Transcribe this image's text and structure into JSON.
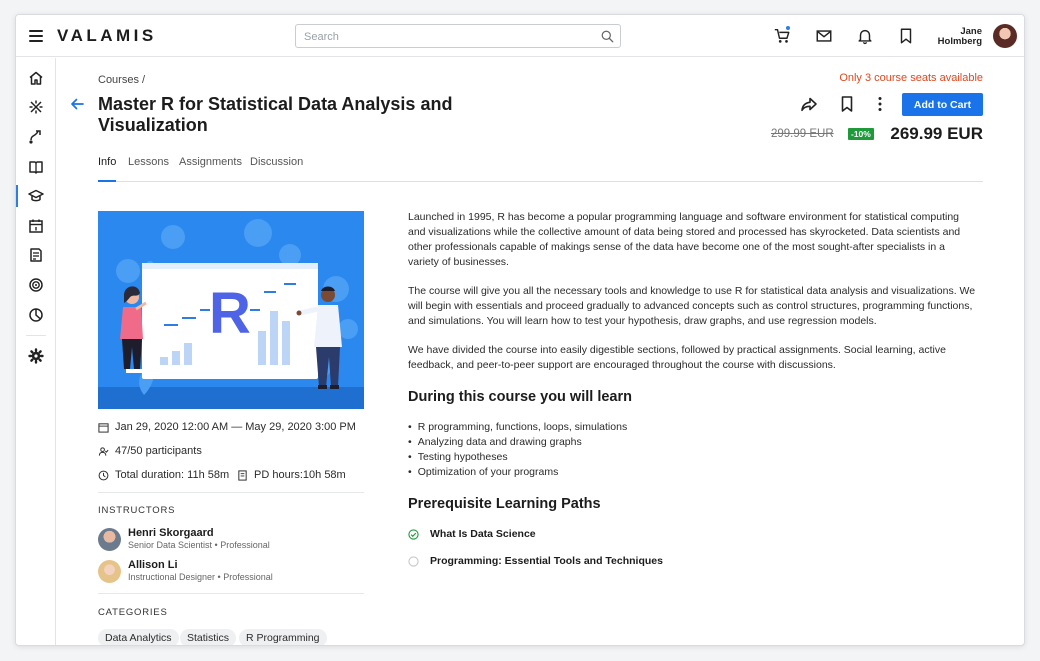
{
  "header": {
    "logo": "VALAMIS",
    "search": {
      "placeholder": "Search",
      "value": ""
    },
    "user": {
      "first_name": "Jane",
      "last_name": "Holmberg"
    },
    "icons": [
      "menu-icon",
      "search-icon",
      "cart-icon",
      "mail-icon",
      "bell-icon",
      "bookmark-icon"
    ],
    "accent_color": "#1a73e8",
    "notification_dot_color": "#2f7de1"
  },
  "sidebar": {
    "items": [
      {
        "icon": "home-icon"
      },
      {
        "icon": "network-icon"
      },
      {
        "icon": "learning-path-icon"
      },
      {
        "icon": "book-icon"
      },
      {
        "icon": "graduation-cap-icon",
        "active": true
      },
      {
        "icon": "calendar-icon"
      },
      {
        "icon": "checklist-icon"
      },
      {
        "icon": "target-icon"
      },
      {
        "icon": "pie-chart-icon"
      },
      {
        "icon": "gear-icon"
      }
    ]
  },
  "course": {
    "breadcrumb": "Courses /",
    "title": "Master R for Statistical Data Analysis and Visualization",
    "seats_notice": "Only 3 course seats available",
    "seats_notice_color": "#e0481f",
    "add_to_cart": "Add to Cart",
    "old_price": "299.99 EUR",
    "discount": "-10%",
    "discount_color": "#1e9a3a",
    "price": "269.99 EUR",
    "tabs": [
      {
        "label": "Info",
        "active": true
      },
      {
        "label": "Lessons"
      },
      {
        "label": "Assignments"
      },
      {
        "label": "Discussion"
      }
    ],
    "hero_letter": "R",
    "dates": "Jan 29, 2020 12:00 AM — May 29, 2020 3:00 PM",
    "participants": "47/50 participants",
    "duration": "Total duration: 11h 58m",
    "pd_hours": "PD hours:10h 58m",
    "instructors_label": "INSTRUCTORS",
    "instructors": [
      {
        "name": "Henri Skorgaard",
        "role": "Senior Data Scientist • Professional"
      },
      {
        "name": "Allison Li",
        "role": "Instructional Designer • Professional"
      }
    ],
    "categories_label": "CATEGORIES",
    "categories": [
      "Data Analytics",
      "Statistics",
      "R Programming"
    ],
    "description": [
      "Launched in 1995, R has become a popular programming language and software environment for statistical computing and visualizations while the collective amount of data being stored and processed has skyrocketed. Data scientists and other professionals capable of makings sense of the data have become one of the most sought-after specialists in a variety of businesses.",
      "The course will give you all the necessary tools and knowledge to use R for statistical data analysis and visualizations. We will begin with essentials and proceed gradually to advanced concepts such as control structures,  programming functions, and simulations. You will learn how to test your hypothesis, draw graphs, and use regression models.",
      "We have divided the course into easily digestible sections, followed by practical assignments. Social learning, active feedback, and peer-to-peer support are encouraged throughout the course with discussions."
    ],
    "learn_heading": "During this course you will learn",
    "learn_items": [
      "R programming, functions, loops, simulations",
      "Analyzing data and drawing graphs",
      "Testing hypotheses",
      "Optimization of your programs"
    ],
    "prereq_heading": "Prerequisite Learning Paths",
    "prereqs": [
      {
        "name": "What Is Data Science",
        "completed": true
      },
      {
        "name": "Programming: Essential Tools and Techniques",
        "completed": false
      }
    ]
  }
}
